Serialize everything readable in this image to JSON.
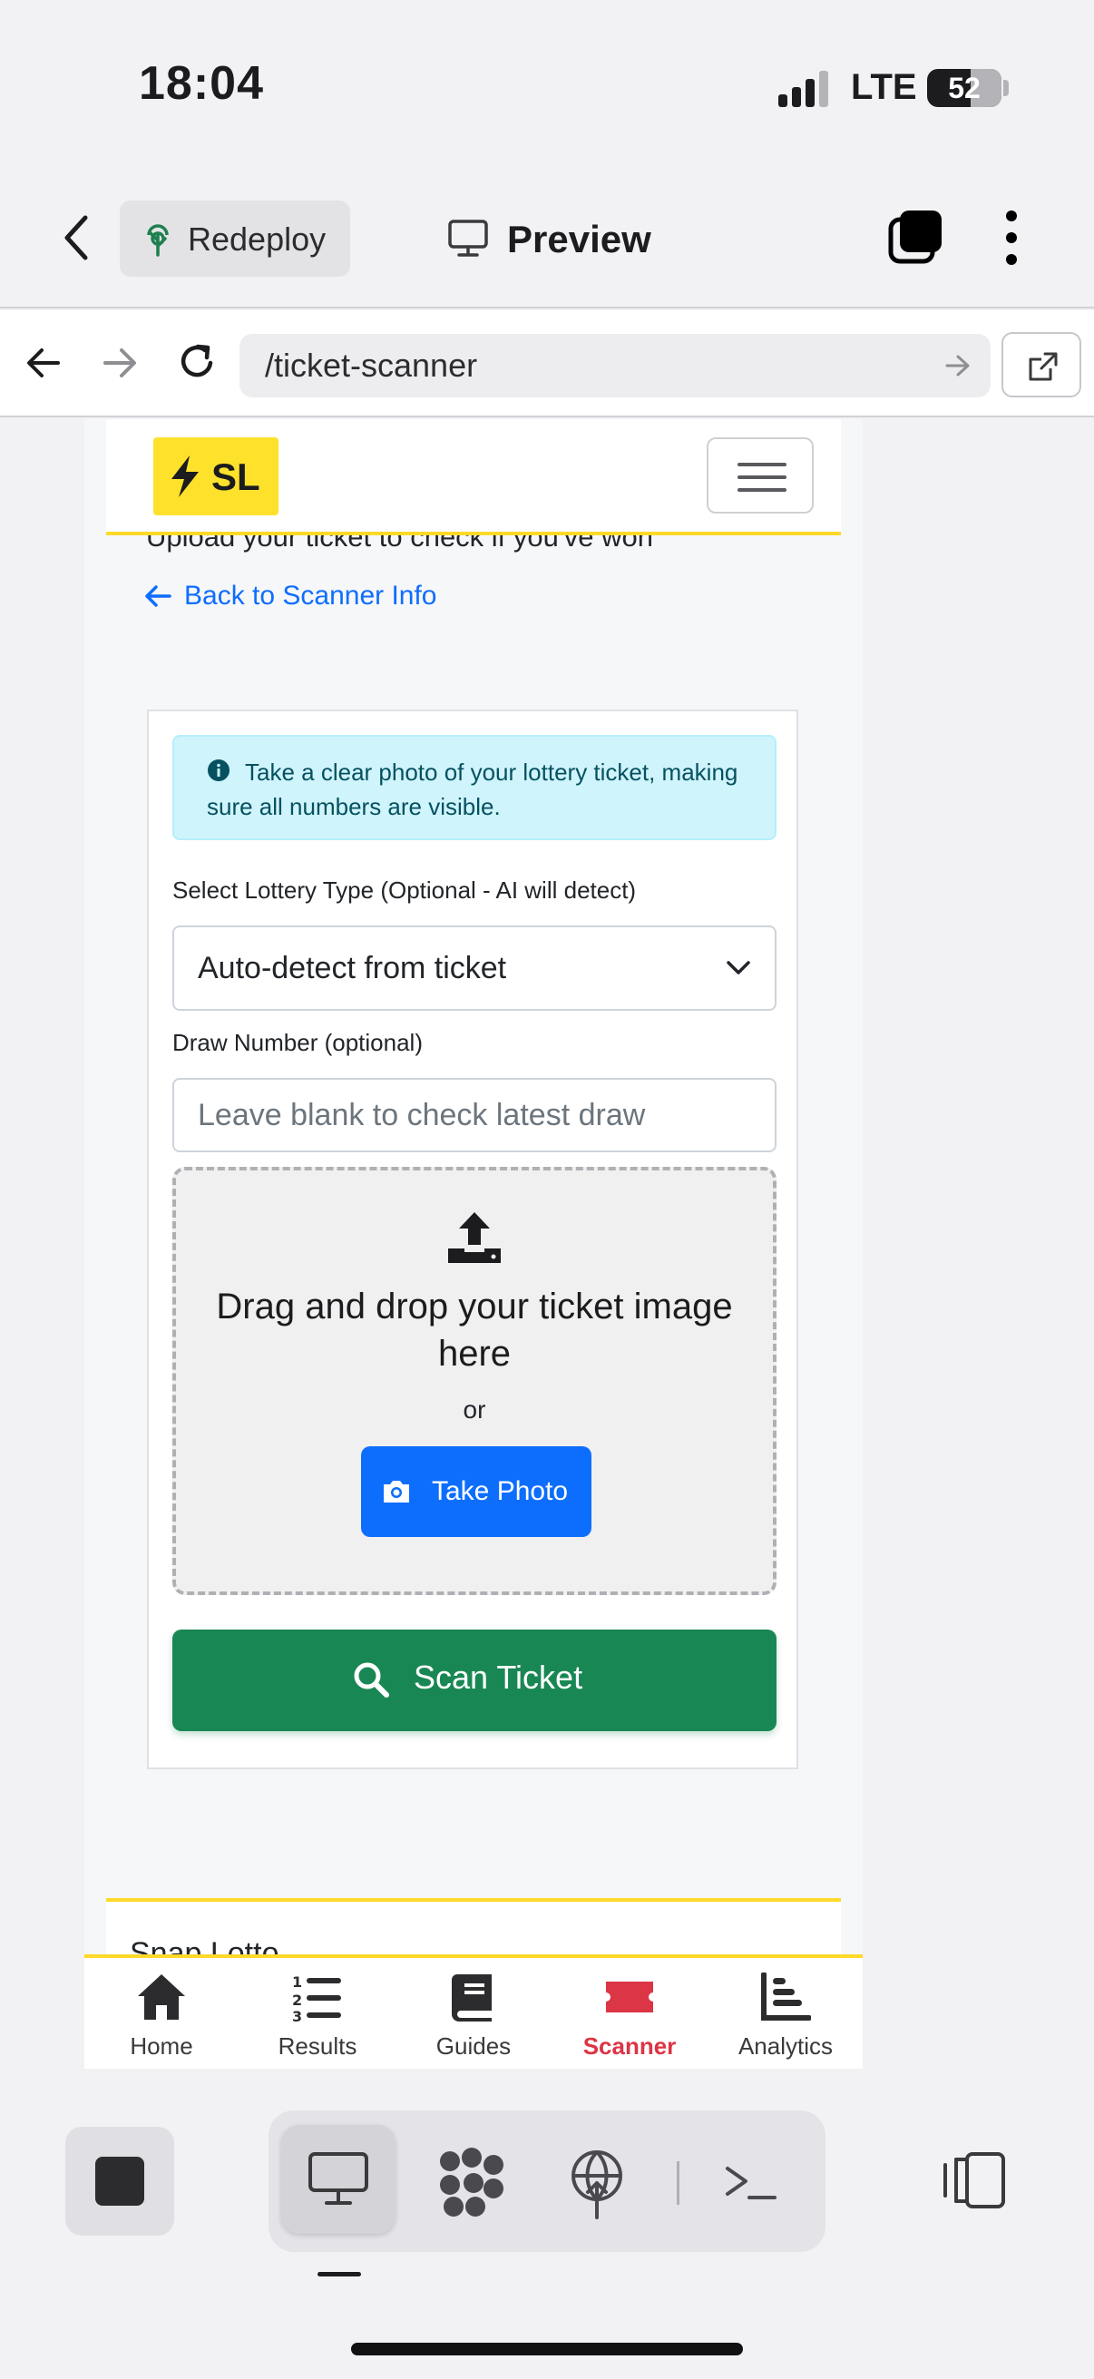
{
  "status_bar": {
    "time": "18:04",
    "network": "LTE",
    "battery": "52"
  },
  "app_bar": {
    "redeploy_label": "Redeploy",
    "preview_label": "Preview"
  },
  "url_bar": {
    "path": "/ticket-scanner"
  },
  "site": {
    "logo_text": "SL",
    "subtitle": "Upload your ticket to check if you've won",
    "back_link": "Back to Scanner Info"
  },
  "scanner": {
    "info_text": "Take a clear photo of your lottery ticket, making sure all numbers are visible.",
    "lottery_type_label": "Select Lottery Type (Optional - AI will detect)",
    "lottery_type_value": "Auto-detect from ticket",
    "draw_number_label": "Draw Number (optional)",
    "draw_number_placeholder": "Leave blank to check latest draw",
    "drop_title": "Drag and drop your ticket image here",
    "drop_or": "or",
    "take_photo_label": "Take Photo",
    "scan_button_label": "Scan Ticket"
  },
  "lower_section": {
    "title": "Snap Lotto"
  },
  "bottom_nav": [
    {
      "label": "Home",
      "icon": "home-icon"
    },
    {
      "label": "Results",
      "icon": "list-ol-icon"
    },
    {
      "label": "Guides",
      "icon": "book-icon"
    },
    {
      "label": "Scanner",
      "icon": "ticket-icon",
      "active": true
    },
    {
      "label": "Analytics",
      "icon": "bar-chart-icon"
    }
  ],
  "colors": {
    "brand_yellow": "#ffd92a",
    "primary_blue": "#0d6efd",
    "success_green": "#198754",
    "active_red": "#dc3545",
    "info_bg": "#cff4fc"
  }
}
